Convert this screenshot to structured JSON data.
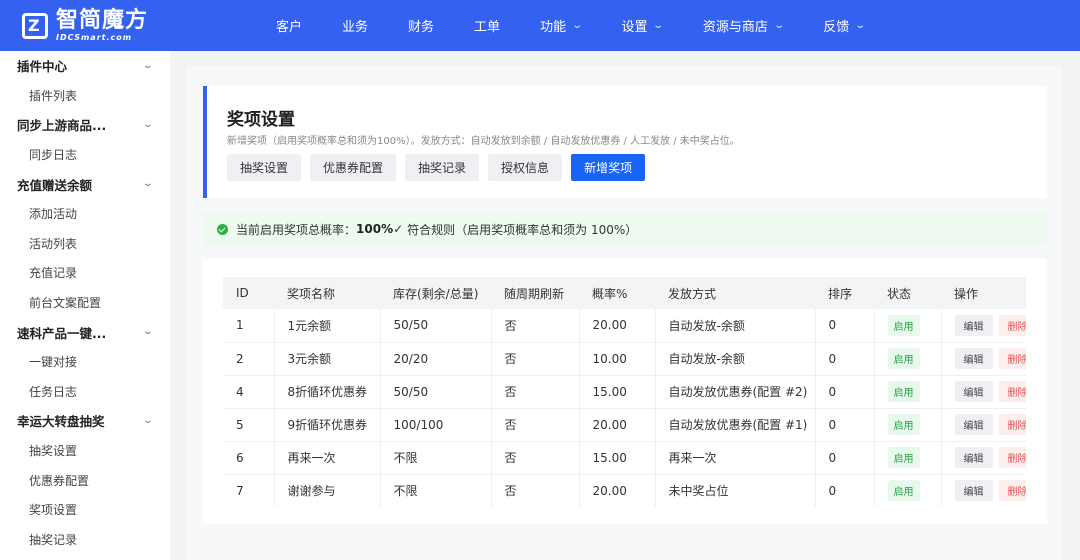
{
  "logo": {
    "main": "智简魔方",
    "sub": "IDCSmart.com",
    "mark": "Z"
  },
  "nav": [
    {
      "label": "客户",
      "dropdown": false
    },
    {
      "label": "业务",
      "dropdown": false
    },
    {
      "label": "财务",
      "dropdown": false
    },
    {
      "label": "工单",
      "dropdown": false
    },
    {
      "label": "功能",
      "dropdown": true
    },
    {
      "label": "设置",
      "dropdown": true
    },
    {
      "label": "资源与商店",
      "dropdown": true
    },
    {
      "label": "反馈",
      "dropdown": true
    }
  ],
  "sidebar": [
    {
      "type": "group",
      "label": "插件中心"
    },
    {
      "type": "item",
      "label": "插件列表"
    },
    {
      "type": "group",
      "label": "同步上游商品..."
    },
    {
      "type": "item",
      "label": "同步日志"
    },
    {
      "type": "group",
      "label": "充值赠送余额"
    },
    {
      "type": "item",
      "label": "添加活动"
    },
    {
      "type": "item",
      "label": "活动列表"
    },
    {
      "type": "item",
      "label": "充值记录"
    },
    {
      "type": "item",
      "label": "前台文案配置"
    },
    {
      "type": "group",
      "label": "速科产品一键..."
    },
    {
      "type": "item",
      "label": "一键对接"
    },
    {
      "type": "item",
      "label": "任务日志"
    },
    {
      "type": "group",
      "label": "幸运大转盘抽奖"
    },
    {
      "type": "item",
      "label": "抽奖设置"
    },
    {
      "type": "item",
      "label": "优惠券配置"
    },
    {
      "type": "item",
      "label": "奖项设置"
    },
    {
      "type": "item",
      "label": "抽奖记录"
    }
  ],
  "header": {
    "title": "奖项设置",
    "desc": "新增奖项（启用奖项概率总和须为100%）。发放方式：自动发放到余额 / 自动发放优惠券 / 人工发放 / 未中奖占位。",
    "tabs": [
      {
        "label": "抽奖设置",
        "active": false
      },
      {
        "label": "优惠券配置",
        "active": false
      },
      {
        "label": "抽奖记录",
        "active": false
      },
      {
        "label": "授权信息",
        "active": false
      },
      {
        "label": "新增奖项",
        "active": true
      }
    ]
  },
  "notice": {
    "prefix": "当前启用奖项总概率：",
    "value": "100%",
    "check": "✓",
    "rule": "符合规则（启用奖项概率总和须为 100%）"
  },
  "table": {
    "columns": [
      "ID",
      "奖项名称",
      "库存(剩余/总量)",
      "随周期刷新",
      "概率%",
      "发放方式",
      "排序",
      "状态",
      "操作"
    ],
    "rows": [
      {
        "id": "1",
        "name": "1元余额",
        "stock": "50/50",
        "refresh": "否",
        "prob": "20.00",
        "method": "自动发放-余额",
        "sort": "0",
        "status": "启用"
      },
      {
        "id": "2",
        "name": "3元余额",
        "stock": "20/20",
        "refresh": "否",
        "prob": "10.00",
        "method": "自动发放-余额",
        "sort": "0",
        "status": "启用"
      },
      {
        "id": "4",
        "name": "8折循环优惠券",
        "stock": "50/50",
        "refresh": "否",
        "prob": "15.00",
        "method": "自动发放优惠券(配置 #2)",
        "sort": "0",
        "status": "启用"
      },
      {
        "id": "5",
        "name": "9折循环优惠券",
        "stock": "100/100",
        "refresh": "否",
        "prob": "20.00",
        "method": "自动发放优惠券(配置 #1)",
        "sort": "0",
        "status": "启用"
      },
      {
        "id": "6",
        "name": "再来一次",
        "stock": "不限",
        "refresh": "否",
        "prob": "15.00",
        "method": "再来一次",
        "sort": "0",
        "status": "启用"
      },
      {
        "id": "7",
        "name": "谢谢参与",
        "stock": "不限",
        "refresh": "否",
        "prob": "20.00",
        "method": "未中奖占位",
        "sort": "0",
        "status": "启用"
      }
    ],
    "edit_label": "编辑",
    "delete_label": "删除"
  },
  "colors": {
    "brand": "#3561f0",
    "primary_button": "#1764f5",
    "success": "#27b24a",
    "danger": "#e55353"
  },
  "icons": {
    "nav_dropdown": "chevron-down-icon",
    "sidebar_group": "chevron-down-icon",
    "notice": "check-circle-icon"
  }
}
